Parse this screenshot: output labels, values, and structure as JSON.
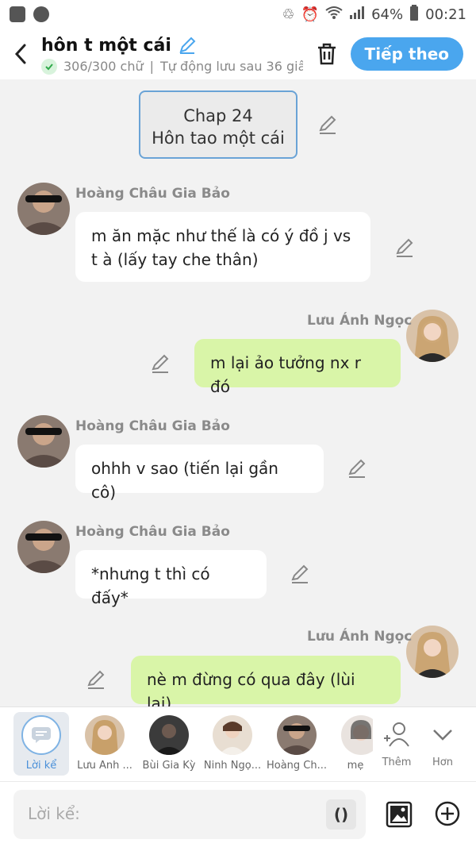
{
  "status_bar": {
    "battery": "64%",
    "time": "00:21"
  },
  "header": {
    "title": "hôn t một cái",
    "char_count": "306/300 chữ",
    "autosave": "Tự động lưu sau 36 giâ",
    "next_label": "Tiếp theo"
  },
  "chapter": {
    "line1": "Chap 24",
    "line2": "Hôn tao một cái"
  },
  "messages": [
    {
      "side": "left",
      "name": "Hoàng Châu Gia Bảo",
      "text": "m ăn mặc như thế là có ý đồ j vs t à (lấy tay che thân)"
    },
    {
      "side": "right",
      "name": "Lưu Ánh Ngọc",
      "text": "m lại ảo tưởng nx r đó"
    },
    {
      "side": "left",
      "name": "Hoàng Châu Gia Bảo",
      "text": "ohhh v sao (tiến lại gần cô)"
    },
    {
      "side": "left",
      "name": "Hoàng Châu Gia Bảo",
      "text": "*nhưng t thì có đấy*"
    },
    {
      "side": "right",
      "name": "Lưu Ánh Ngọc",
      "text": "nè m đừng có qua đây (lùi lại)"
    }
  ],
  "characters": [
    {
      "label": "Lời kể"
    },
    {
      "label": "Lưu Ánh ..."
    },
    {
      "label": "Bùi Gia Kỳ"
    },
    {
      "label": "Ninh Ngọ..."
    },
    {
      "label": "Hoàng Ch..."
    },
    {
      "label": "mẹ"
    }
  ],
  "more": {
    "add_label": "Thêm",
    "more_label": "Hơn"
  },
  "input": {
    "placeholder": "Lời kể:",
    "paren": "()"
  },
  "colors": {
    "accent": "#4aa6ee",
    "bubble_right": "#d9f5a8",
    "bubble_left": "#ffffff"
  }
}
